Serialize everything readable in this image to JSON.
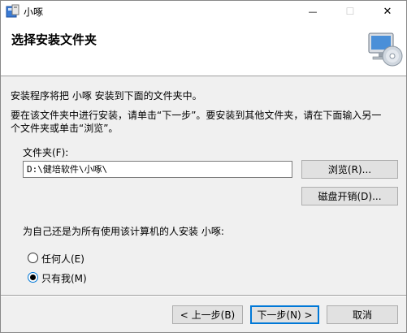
{
  "window": {
    "title": "小啄",
    "minimize_glyph": "—",
    "maximize_glyph": "☐",
    "close_glyph": "✕"
  },
  "header": {
    "title": "选择安装文件夹"
  },
  "body": {
    "intro": "安装程序将把 小啄 安装到下面的文件夹中。",
    "instructions_line1": "要在该文件夹中进行安装，请单击“下一步”。要安装到其他文件夹，请在下面输入另一",
    "instructions_line2": "个文件夹或单击“浏览”。"
  },
  "folder": {
    "label": "文件夹(F):",
    "value": "D:\\健培软件\\小啄\\",
    "browse_label": "浏览(R)...",
    "disk_cost_label": "磁盘开销(D)..."
  },
  "install_for": {
    "question": "为自己还是为所有使用该计算机的人安装 小啄:",
    "options": [
      {
        "label": "任何人(E)",
        "selected": false
      },
      {
        "label": "只有我(M)",
        "selected": true
      }
    ]
  },
  "footer": {
    "back_label": "< 上一步(B)",
    "next_label": "下一步(N) >",
    "cancel_label": "取消"
  },
  "colors": {
    "accent": "#0078d7",
    "dialog_bg": "#f0f0f0"
  }
}
